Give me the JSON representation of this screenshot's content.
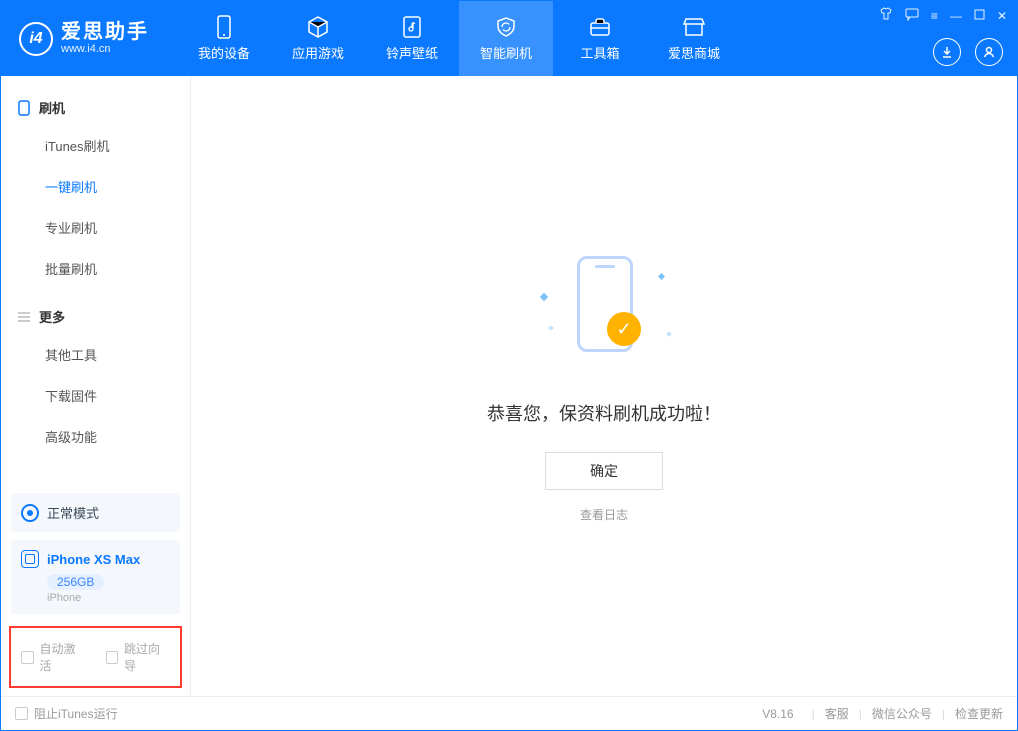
{
  "logo": {
    "title": "爱思助手",
    "subtitle": "www.i4.cn"
  },
  "tabs": {
    "device": "我的设备",
    "apps": "应用游戏",
    "ringtone": "铃声壁纸",
    "flash": "智能刷机",
    "toolbox": "工具箱",
    "store": "爱思商城"
  },
  "sidebar": {
    "section_flash": "刷机",
    "items_flash": {
      "itunes": "iTunes刷机",
      "onekey": "一键刷机",
      "pro": "专业刷机",
      "batch": "批量刷机"
    },
    "section_more": "更多",
    "items_more": {
      "other": "其他工具",
      "firmware": "下载固件",
      "advanced": "高级功能"
    }
  },
  "mode": {
    "label": "正常模式"
  },
  "device": {
    "name": "iPhone XS Max",
    "storage": "256GB",
    "type": "iPhone"
  },
  "options": {
    "auto_activate": "自动激活",
    "skip_guide": "跳过向导"
  },
  "main": {
    "message": "恭喜您，保资料刷机成功啦！",
    "ok": "确定",
    "view_log": "查看日志"
  },
  "status": {
    "block_itunes": "阻止iTunes运行",
    "version": "V8.16",
    "support": "客服",
    "wechat": "微信公众号",
    "update": "检查更新"
  }
}
